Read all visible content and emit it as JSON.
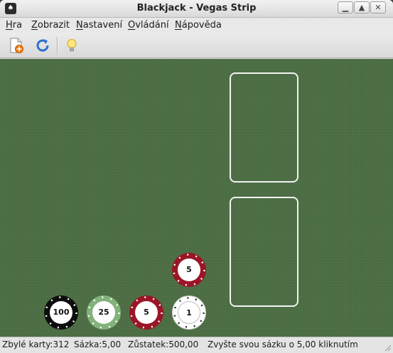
{
  "window": {
    "title": "Blackjack - Vegas Strip"
  },
  "menu": [
    {
      "label": "Hra"
    },
    {
      "label": "Zobrazit"
    },
    {
      "label": "Nastavení"
    },
    {
      "label": "Ovládání"
    },
    {
      "label": "Nápověda"
    }
  ],
  "toolbar": {
    "icons": [
      "new-game-icon",
      "redeal-icon",
      "hint-icon"
    ]
  },
  "table": {
    "chips": [
      {
        "value": "100",
        "color": "#0d0d0d"
      },
      {
        "value": "25",
        "color": "#83b27a"
      },
      {
        "value": "5",
        "color": "#9a1626"
      },
      {
        "value": "1",
        "color": "#ffffff"
      }
    ],
    "bet_chip": {
      "value": "5",
      "color": "#9a1626"
    },
    "felt_color": "#4b6d43"
  },
  "status": {
    "cards_left": "Zbylé karty:312",
    "bet": "Sázka:5,00",
    "balance": "Zůstatek:500,00",
    "message": "Zvyšte svou sázku o 5,00 kliknutím"
  }
}
